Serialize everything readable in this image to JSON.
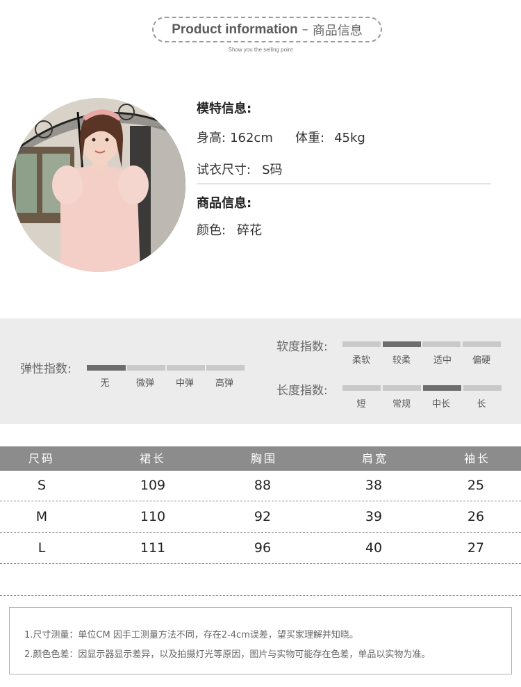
{
  "header": {
    "title_en": "Product information",
    "dash": "–",
    "title_zh": "商品信息",
    "subtitle": "Show you the selling point"
  },
  "model": {
    "heading": "模特信息:",
    "height_label": "身高:",
    "height_value": "162cm",
    "weight_label": "体重:",
    "weight_value": "45kg",
    "size_label": "试衣尺寸:",
    "size_value": "S码"
  },
  "product": {
    "heading": "商品信息:",
    "color_label": "颜色:",
    "color_value": "碎花"
  },
  "indices": {
    "elasticity": {
      "label": "弹性指数:",
      "options": [
        "无",
        "微弹",
        "中弹",
        "高弹"
      ],
      "selected": 0
    },
    "softness": {
      "label": "软度指数:",
      "options": [
        "柔软",
        "较柔",
        "适中",
        "偏硬"
      ],
      "selected": 1
    },
    "length": {
      "label": "长度指数:",
      "options": [
        "短",
        "常规",
        "中长",
        "长"
      ],
      "selected": 2
    }
  },
  "size_table": {
    "headers": [
      "尺码",
      "裙长",
      "胸围",
      "肩宽",
      "袖长"
    ],
    "rows": [
      [
        "S",
        "109",
        "88",
        "38",
        "25"
      ],
      [
        "M",
        "110",
        "92",
        "39",
        "26"
      ],
      [
        "L",
        "111",
        "96",
        "40",
        "27"
      ]
    ]
  },
  "notes": [
    "1.尺寸测量：单位CM 因手工测量方法不同，存在2-4cm误差，望买家理解并知晓。",
    "2.颜色色差：因显示器显示差异，以及拍摄灯光等原因，图片与实物可能存在色差，单品以实物为准。"
  ],
  "colors": {
    "band_bg": "#ececec",
    "bar_on": "#6d6d6d",
    "bar_off": "#c9c9c9",
    "table_header_bg": "#8c8c8c"
  }
}
